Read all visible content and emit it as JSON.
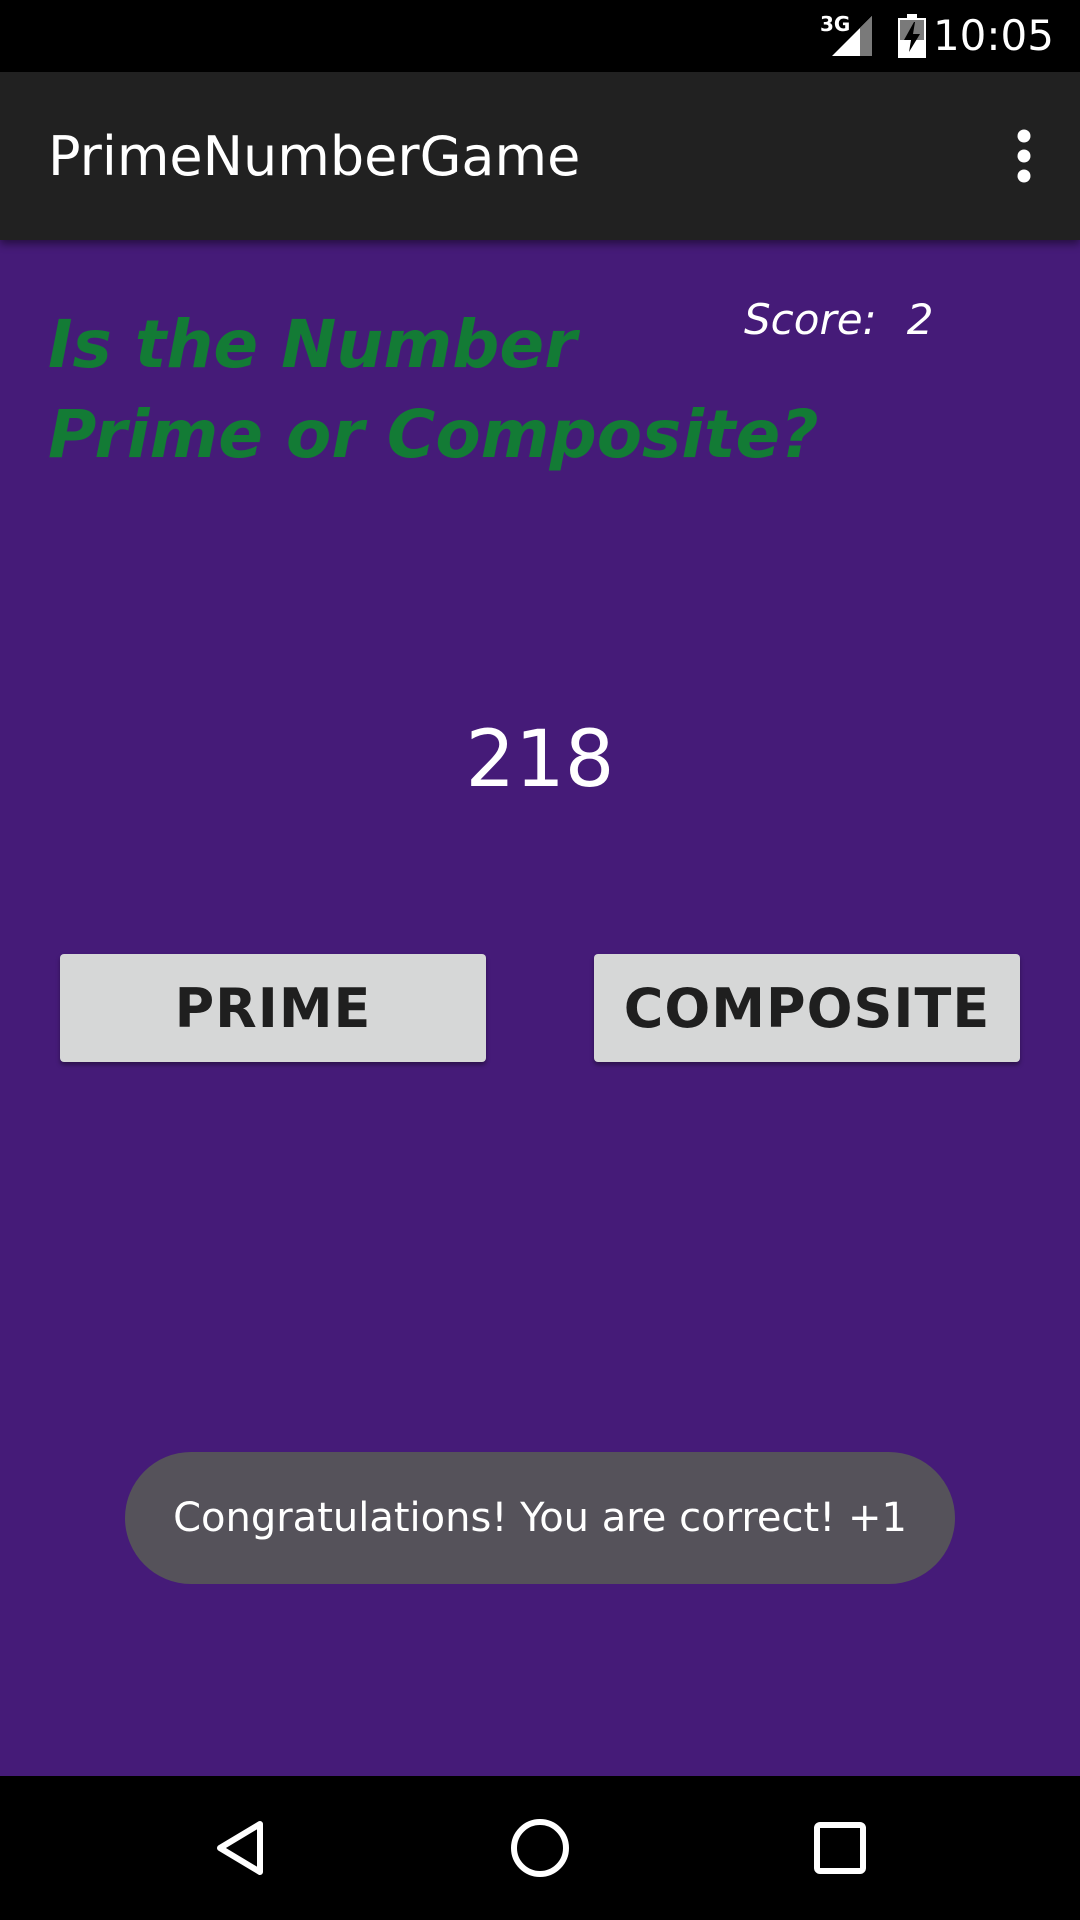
{
  "status_bar": {
    "network": "3G",
    "time": "10:05"
  },
  "app_bar": {
    "title": "PrimeNumberGame",
    "overflow_icon": "more-vert-icon"
  },
  "game": {
    "question_line1": "Is the Number",
    "question_line2": "Prime or Composite?",
    "score_label": "Score:",
    "score_value": "2",
    "number": "218",
    "prime_label": "PRIME",
    "composite_label": "COMPOSITE"
  },
  "toast": {
    "message": "Congratulations! You are correct! +1"
  },
  "nav_bar": {
    "back_icon": "back-triangle-icon",
    "home_icon": "home-circle-icon",
    "recents_icon": "recents-square-icon"
  },
  "colors": {
    "background": "#451b78",
    "app_bar": "#212121",
    "question_text": "#137b35",
    "button_bg": "#d6d7d7",
    "toast_bg": "#55525a"
  }
}
